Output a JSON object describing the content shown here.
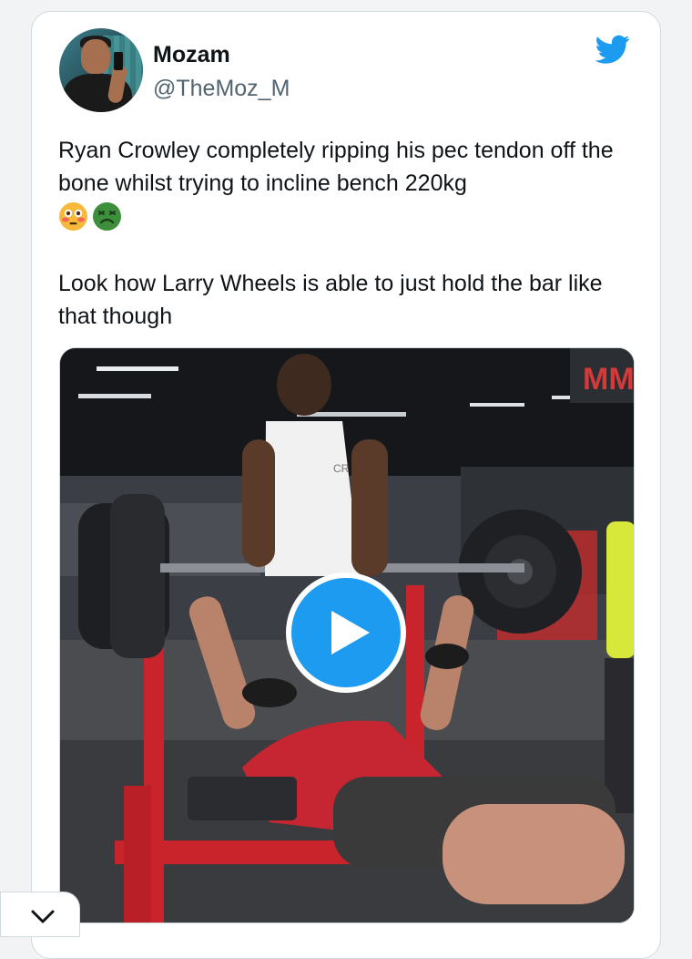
{
  "tweet": {
    "author_name": "Mozam",
    "author_handle": "@TheMoz_M",
    "text_line1": "Ryan Crowley completely ripping his pec tendon off the bone whilst trying to incline bench 220kg",
    "text_line2": "Look how Larry Wheels is able to just hold the bar like that though",
    "emojis": [
      "flushed-face-emoji",
      "nauseated-face-emoji"
    ]
  },
  "media": {
    "type": "video",
    "play_icon": "play-icon",
    "gym_sign_text": "MM",
    "shirt_logo_text": "CR"
  },
  "colors": {
    "brand_blue": "#1d9bf0",
    "text_primary": "#0f1419",
    "text_secondary": "#536471"
  },
  "icons": {
    "twitter": "twitter-bird-icon",
    "collapse": "chevron-down-icon"
  }
}
